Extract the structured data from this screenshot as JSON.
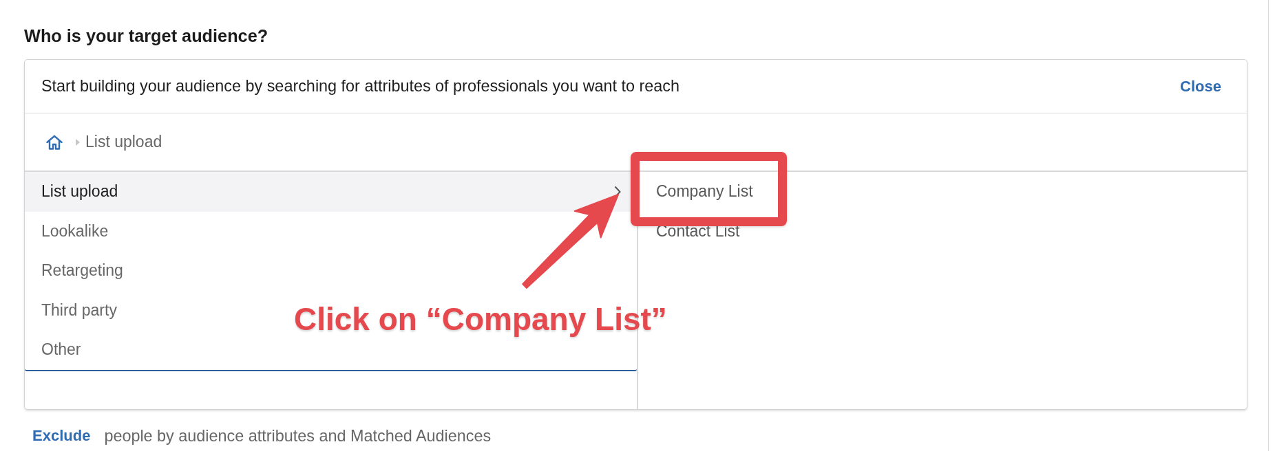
{
  "heading": "Who is your target audience?",
  "audience_builder": {
    "prompt": "Start building your audience by searching for attributes of professionals you want to reach",
    "close_link": "Close",
    "breadcrumb": [
      "List upload"
    ],
    "categories": [
      {
        "label": "List upload",
        "selected": true
      },
      {
        "label": "Lookalike",
        "selected": false
      },
      {
        "label": "Retargeting",
        "selected": false
      },
      {
        "label": "Third party",
        "selected": false
      },
      {
        "label": "Other",
        "selected": false
      }
    ],
    "subcategories": [
      {
        "label": "Company List",
        "highlighted": true
      },
      {
        "label": "Contact List",
        "highlighted": false
      }
    ]
  },
  "exclude": {
    "link": "Exclude",
    "text": "people by audience attributes and Matched Audiences"
  },
  "annotation": {
    "text": "Click on “Company List”"
  }
}
